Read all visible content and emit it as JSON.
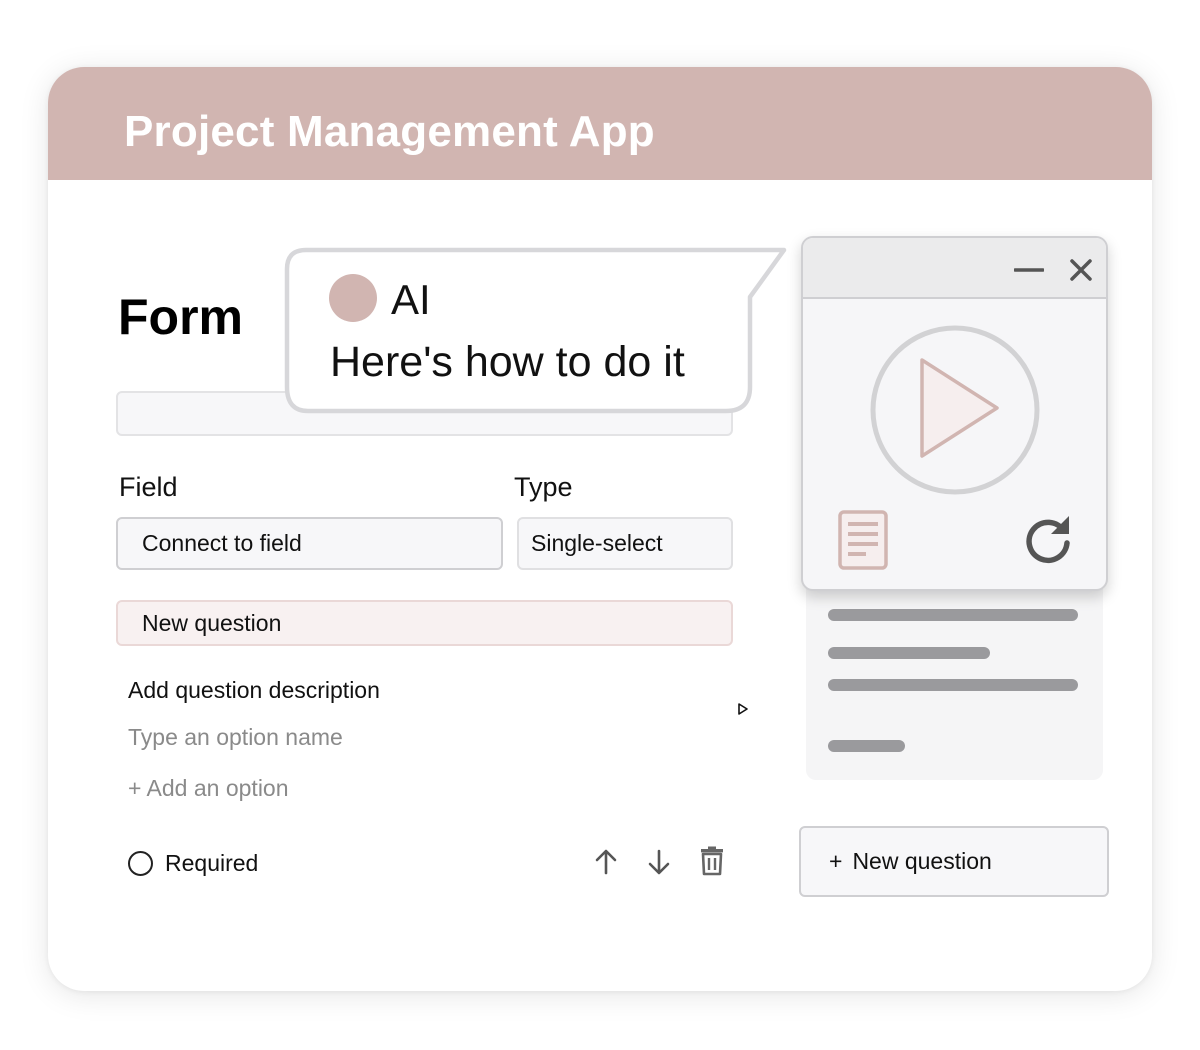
{
  "app": {
    "title": "Project Management App"
  },
  "form": {
    "title": "Form",
    "field_label": "Field",
    "type_label": "Type",
    "field_value": "Connect to field",
    "type_value": "Single-select",
    "question_value": "New question",
    "description_label": "Add question description",
    "option_placeholder": "Type an option name",
    "add_option_label": "+ Add an option",
    "required_label": "Required"
  },
  "assistant": {
    "name": "AI",
    "message": "Here's how to do it"
  },
  "right_panel": {
    "new_question_plus": "+",
    "new_question_label": "New question"
  },
  "colors": {
    "accent": "#d1b5b1",
    "header_text": "#ffffff",
    "muted_text": "#8a8a8a",
    "border": "#cfcfd2",
    "placeholder_line": "#9a9a9d"
  },
  "icons": {
    "video_window": [
      "minimize-icon",
      "close-icon",
      "play-icon",
      "document-icon",
      "refresh-icon"
    ],
    "question_actions": [
      "arrow-up-icon",
      "arrow-down-icon",
      "trash-icon"
    ],
    "pointer": "cursor-icon",
    "assistant": "avatar"
  }
}
